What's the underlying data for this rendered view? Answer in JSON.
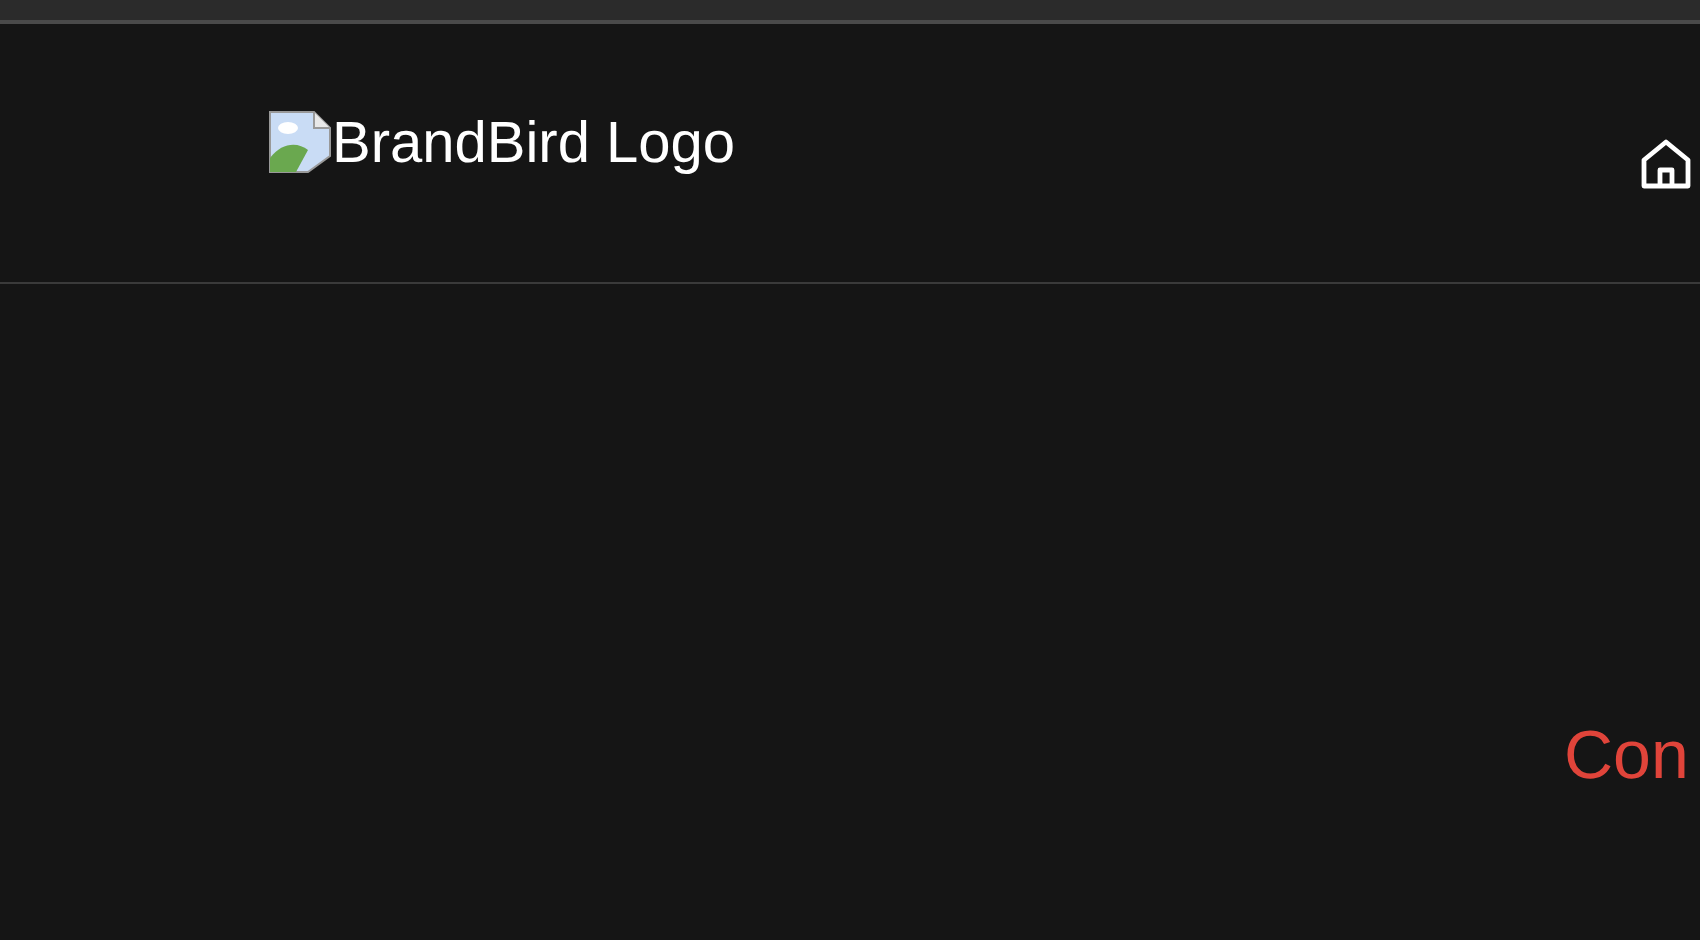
{
  "header": {
    "logo_alt": "BrandBird Logo"
  },
  "main": {
    "heading": "Con"
  }
}
